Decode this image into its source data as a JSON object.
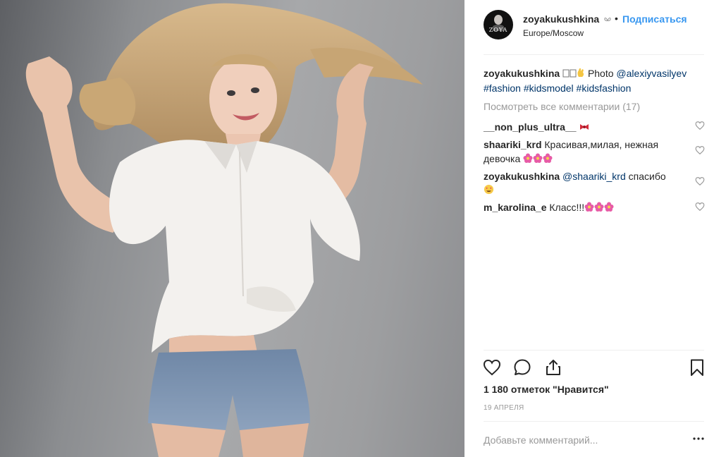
{
  "post": {
    "username": "zoyakukushkina",
    "follow_label": "Подписаться",
    "separator": "•",
    "location": "Europe/Moscow",
    "avatar_text": "ZOYA",
    "photo_alt": "Post photo"
  },
  "caption": {
    "username": "zoyakukushkina",
    "prefix": "Photo",
    "mention": "@alexiyvasilyev",
    "hashtags": [
      "#fashion",
      "#kidsmodel",
      "#kidsfashion"
    ],
    "icons": [
      "bow-icon",
      "bow-icon",
      "hand-icon"
    ]
  },
  "comments": {
    "view_all_label": "Посмотреть все комментарии (17)",
    "items": [
      {
        "user": "__non_plus_ultra__",
        "text": "",
        "icons": [
          "bow-icon"
        ]
      },
      {
        "user": "shaariki_krd",
        "text": "Красивая,милая, нежная девочка",
        "icons": [
          "flower-icon",
          "flower-icon",
          "flower-icon"
        ]
      },
      {
        "user": "zoyakukushkina",
        "mention": "@shaariki_krd",
        "text": "спасибо",
        "icons": [
          "smile-heart-eyes-icon"
        ]
      },
      {
        "user": "m_karolina_e",
        "text": "Класс!!!",
        "icons": [
          "flower-icon",
          "flower-icon",
          "flower-icon"
        ]
      }
    ]
  },
  "actions": {
    "likes_label": "1 180 отметок \"Нравится\"",
    "date_label": "19 АПРЕЛЯ",
    "comment_placeholder": "Добавьте комментарий..."
  },
  "colors": {
    "link": "#003569",
    "follow": "#3897f0",
    "muted": "#999999",
    "flower": "#e75ba6"
  }
}
